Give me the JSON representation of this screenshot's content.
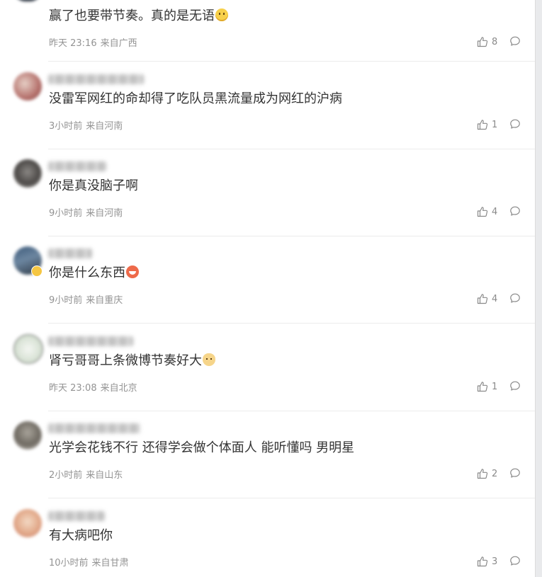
{
  "comments": [
    {
      "text": "赢了也要带节奏。真的是无语",
      "time": "昨天 23:16",
      "location": "来自广西",
      "likes": "8",
      "emoji": "smile-emoji"
    },
    {
      "text": "没雷军网红的命却得了吃队员黑流量成为网红的沪病",
      "time": "3小时前",
      "location": "来自河南",
      "likes": "1"
    },
    {
      "text": "你是真没脑子啊",
      "time": "9小时前",
      "location": "来自河南",
      "likes": "4"
    },
    {
      "text": "你是什么东西",
      "time": "9小时前",
      "location": "来自重庆",
      "likes": "4",
      "emoji": "laugh-emoji"
    },
    {
      "text": "肾亏哥哥上条微博节奏好大",
      "time": "昨天 23:08",
      "location": "来自北京",
      "likes": "1",
      "emoji": "cat-emoji"
    },
    {
      "text": "光学会花钱不行 还得学会做个体面人 能听懂吗 男明星",
      "time": "2小时前",
      "location": "来自山东",
      "likes": "2"
    },
    {
      "text": "有大病吧你",
      "time": "10小时前",
      "location": "来自甘肃",
      "likes": "3"
    }
  ],
  "icons": {
    "like": "thumb-up-icon",
    "reply": "speech-bubble-icon"
  },
  "colors": {
    "text": "#333333",
    "meta": "#939393",
    "icon": "#8a8a8a",
    "background": "#ffffff"
  }
}
